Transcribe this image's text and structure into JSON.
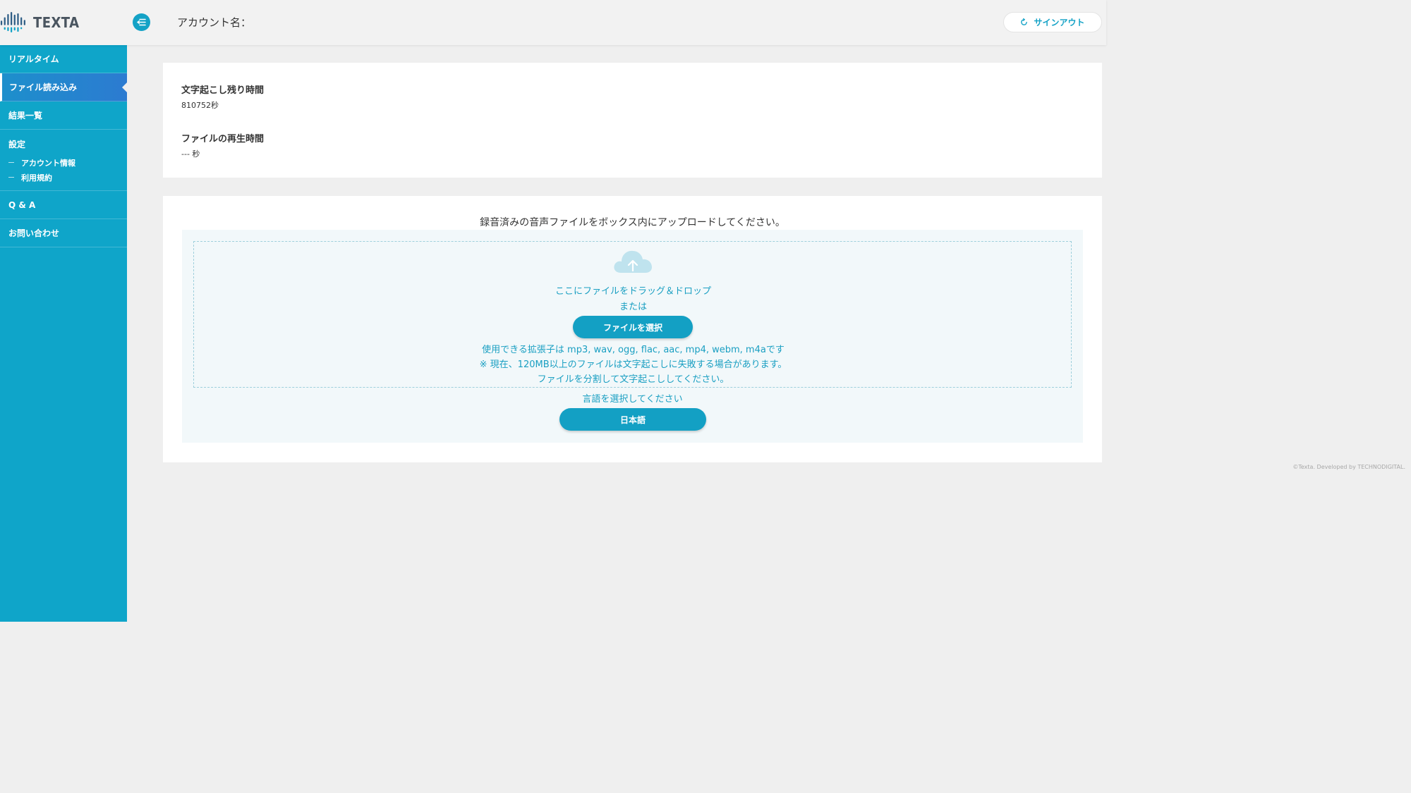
{
  "header": {
    "logo_text": "TEXTA",
    "menu_toggle_icon": "menu-collapse-icon",
    "account_label": "アカウント名：",
    "signout_label": "サインアウト",
    "signout_icon": "refresh-icon"
  },
  "sidebar": {
    "items": [
      {
        "label": "リアルタイム"
      },
      {
        "label": "ファイル読み込み",
        "active": true
      },
      {
        "label": "結果一覧"
      }
    ],
    "settings": {
      "title": "設定",
      "children": [
        {
          "label": "アカウント情報"
        },
        {
          "label": "利用規約"
        }
      ]
    },
    "bottom_items": [
      {
        "label": "Q & A"
      },
      {
        "label": "お問い合わせ"
      }
    ]
  },
  "info": {
    "remaining_title": "文字起こし残り時間",
    "remaining_value": "810752秒",
    "playback_title": "ファイルの再生時間",
    "playback_value": "--- 秒"
  },
  "upload": {
    "heading": "録音済みの音声ファイルをボックス内にアップロードしてください。",
    "drop_text": "ここにファイルをドラッグ＆ドロップ",
    "or_text": "または",
    "select_button": "ファイルを選択",
    "extensions_note": "使用できる拡張子は mp3, wav, ogg, flac, aac, mp4, webm, m4aです",
    "size_warning": "※ 現在、120MB以上のファイルは文字起こしに失敗する場合があります。",
    "split_note": "ファイルを分割して文字起こししてください。",
    "language_label": "言語を選択してください",
    "language_value": "日本語"
  },
  "footer": {
    "copyright": "©Texta. Developed by TECHNODIGITAL."
  },
  "colors": {
    "accent": "#14a2c6",
    "sidebar_bg": "#0fa5c9",
    "sidebar_active": "#2c7bd1",
    "page_bg": "#efefef"
  }
}
